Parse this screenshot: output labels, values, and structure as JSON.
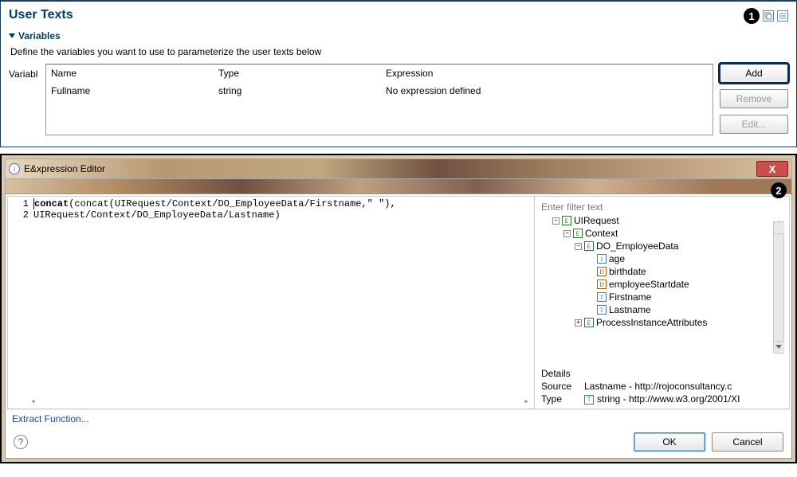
{
  "topPanel": {
    "title": "User Texts",
    "callout1": "1",
    "section": {
      "label": "Variables",
      "description": "Define the variables you want to use to parameterize the user texts below",
      "fieldLabel": "Variabl"
    },
    "table": {
      "headers": {
        "name": "Name",
        "type": "Type",
        "expr": "Expression"
      },
      "rows": [
        {
          "name": "Fullname",
          "type": "string",
          "expr": "No expression defined"
        }
      ]
    },
    "buttons": {
      "add": "Add",
      "remove": "Remove",
      "edit": "Edit..."
    }
  },
  "dialog": {
    "callout2": "2",
    "title": "E&xpression Editor",
    "closeGlyph": "X",
    "code": {
      "line1_num": "1",
      "line1_kw": "concat",
      "line1_rest": "(concat(UIRequest/Context/DO_EmployeeData/Firstname,\" \"),",
      "line2_num": "2",
      "line2": "UIRequest/Context/DO_EmployeeData/Lastname)"
    },
    "filterPlaceholder": "Enter filter text",
    "tree": {
      "n1": "UIRequest",
      "n2": "Context",
      "n3": "DO_EmployeeData",
      "n4": "age",
      "n5": "birthdate",
      "n6": "employeeStartdate",
      "n7": "Firstname",
      "n8": "Lastname",
      "n9": "ProcessInstanceAttributes"
    },
    "details": {
      "heading": "Details",
      "sourceLabel": "Source",
      "sourceValue": "Lastname - http://rojoconsultancy.c",
      "typeLabel": "Type",
      "typeValue": "string - http://www.w3.org/2001/XI"
    },
    "extractLink": "Extract Function...",
    "footer": {
      "help": "?",
      "ok": "OK",
      "cancel": "Cancel"
    }
  }
}
